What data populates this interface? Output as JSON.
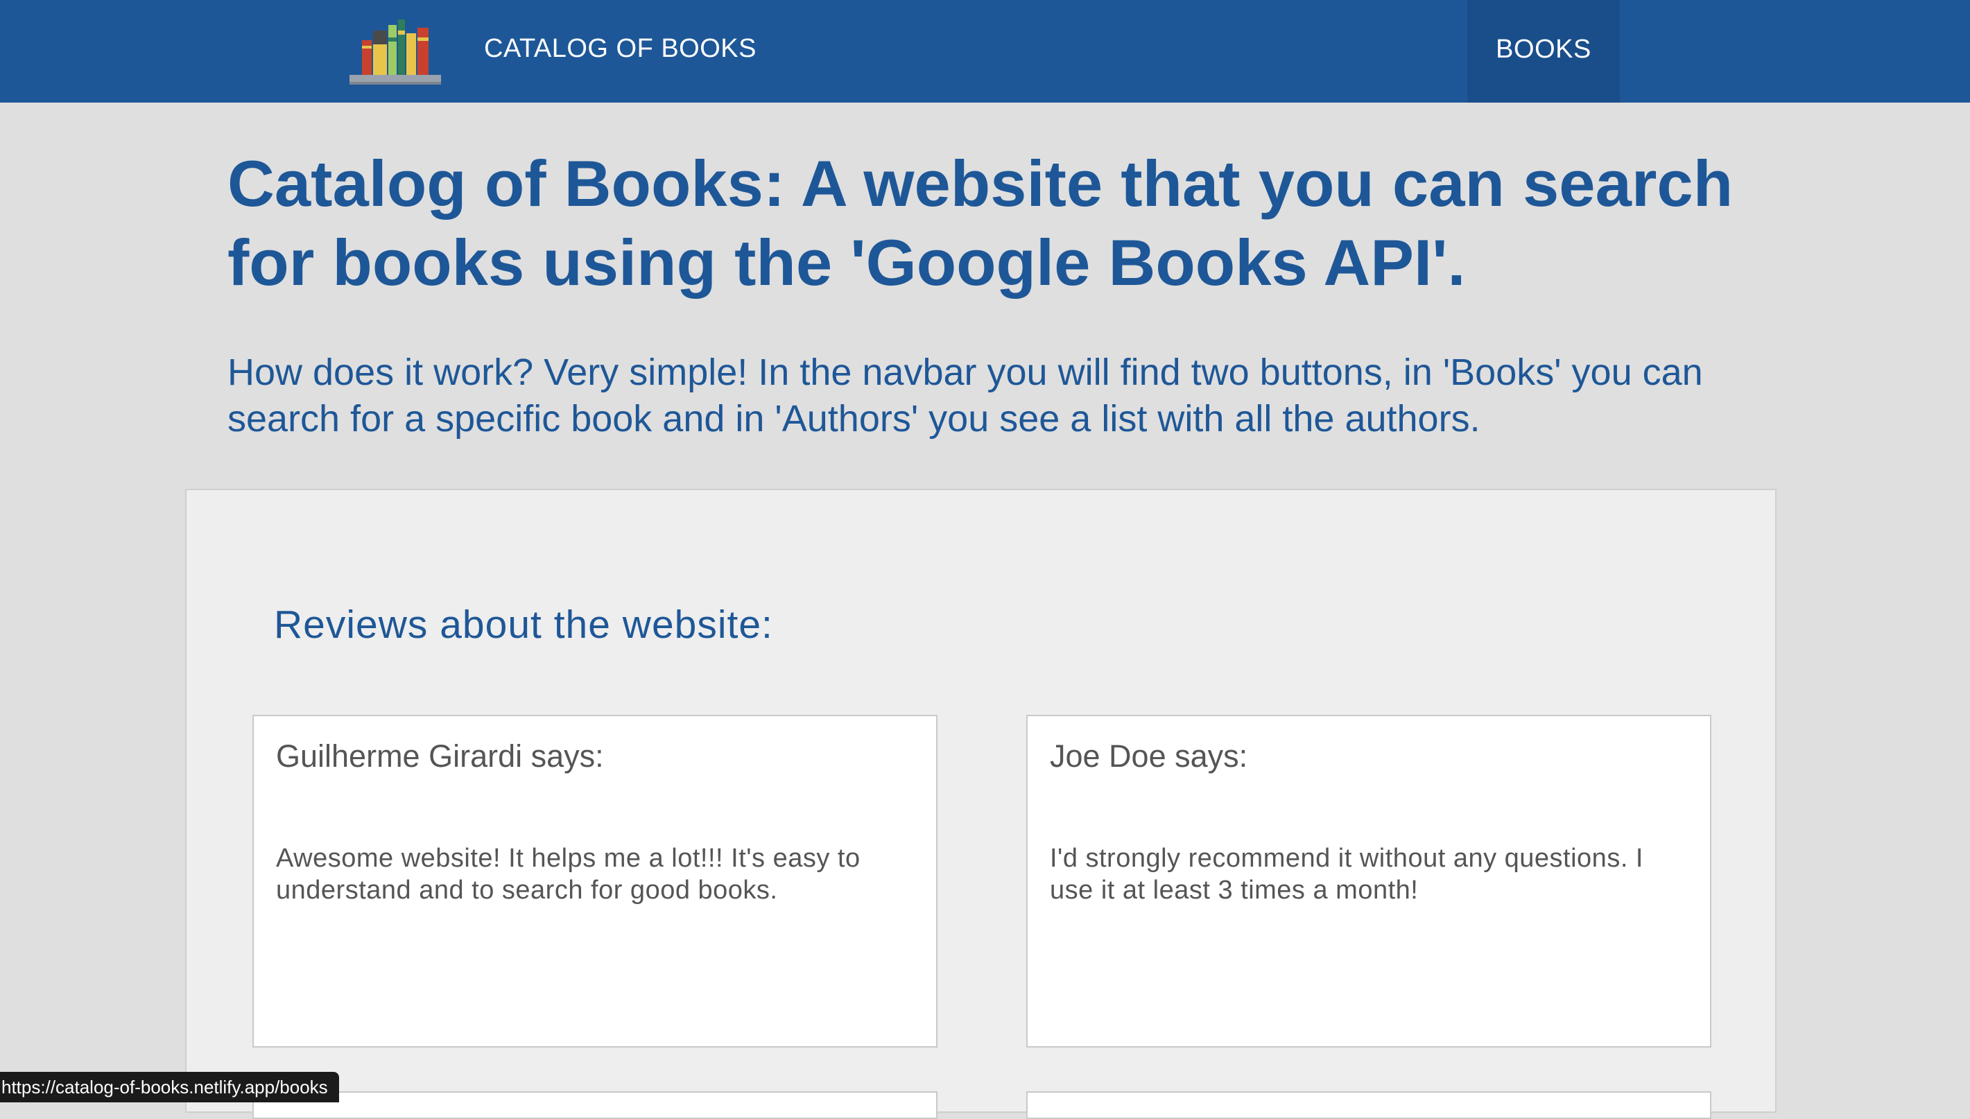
{
  "navbar": {
    "brand": "CATALOG OF BOOKS",
    "logo_icon": "bookshelf-icon",
    "books_link": "BOOKS",
    "background_color": "#1e5797"
  },
  "main": {
    "title": "Catalog of Books: A website that you can search for books using the 'Google Books API'.",
    "intro": "How does it work? Very simple! In the navbar you will find two buttons, in 'Books' you can search for a specific book and in 'Authors' you see a list with all the authors."
  },
  "reviews": {
    "title": "Reviews about the website:",
    "items": [
      {
        "author": "Guilherme Girardi says:",
        "text": "Awesome website! It helps me a lot!!! It's easy to understand and to search for good books."
      },
      {
        "author": "Joe Doe says:",
        "text": "I'd strongly recommend it without any questions. I use it at least 3 times a month!"
      }
    ]
  },
  "status_bar": {
    "url": "https://catalog-of-books.netlify.app/books"
  }
}
